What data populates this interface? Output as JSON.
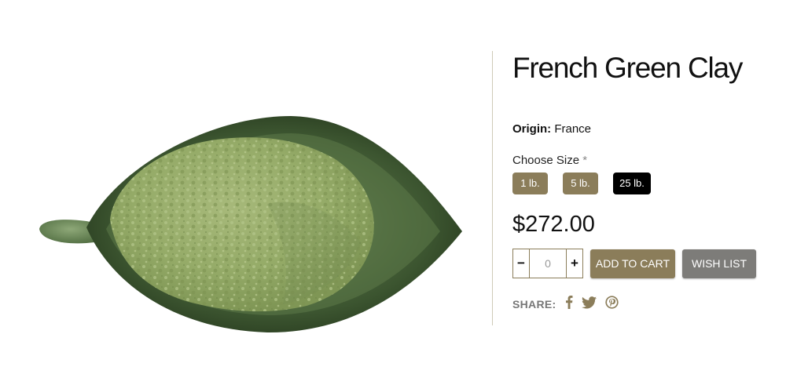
{
  "product": {
    "title": "French Green Clay",
    "origin_label": "Origin:",
    "origin_value": "France",
    "size_label": "Choose Size",
    "size_required": "*",
    "sizes": [
      {
        "label": "1 lb.",
        "selected": false
      },
      {
        "label": "5 lb.",
        "selected": false
      },
      {
        "label": "25 lb.",
        "selected": true
      }
    ],
    "price": "$272.00"
  },
  "quantity": {
    "minus": "−",
    "value": "0",
    "plus": "+"
  },
  "actions": {
    "add_to_cart": "ADD TO CART",
    "wish_list": "WISH LIST"
  },
  "share": {
    "label": "SHARE:",
    "icons": [
      "facebook-icon",
      "twitter-icon",
      "pinterest-icon"
    ]
  },
  "colors": {
    "accent": "#8b7d5a",
    "selected": "#000000",
    "wishlist": "#7d7c79",
    "social": "#8b7d5a"
  }
}
